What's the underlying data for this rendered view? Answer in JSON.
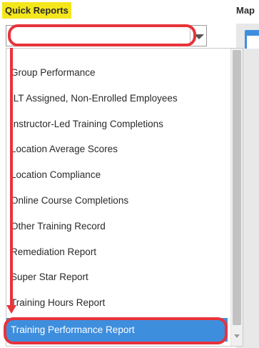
{
  "header": {
    "quick_reports_label": "Quick Reports",
    "map_label": "Map"
  },
  "select": {
    "value": "",
    "arrow_icon": "chevron-down-icon"
  },
  "dropdown": {
    "items": [
      {
        "label": "Group Performance"
      },
      {
        "label": "ILT Assigned, Non-Enrolled Employees"
      },
      {
        "label": "Instructor-Led Training Completions"
      },
      {
        "label": "Location Average Scores"
      },
      {
        "label": "Location Compliance"
      },
      {
        "label": "Online Course Completions"
      },
      {
        "label": "Other Training Record"
      },
      {
        "label": "Remediation Report"
      },
      {
        "label": "Super Star Report"
      },
      {
        "label": "Training Hours Report"
      },
      {
        "label": "Training Performance Report"
      }
    ],
    "selected_index": 10
  },
  "colors": {
    "label_highlight": "#f4e61c",
    "selection_blue": "#3e8ede",
    "annotation_red": "#e8333a"
  }
}
